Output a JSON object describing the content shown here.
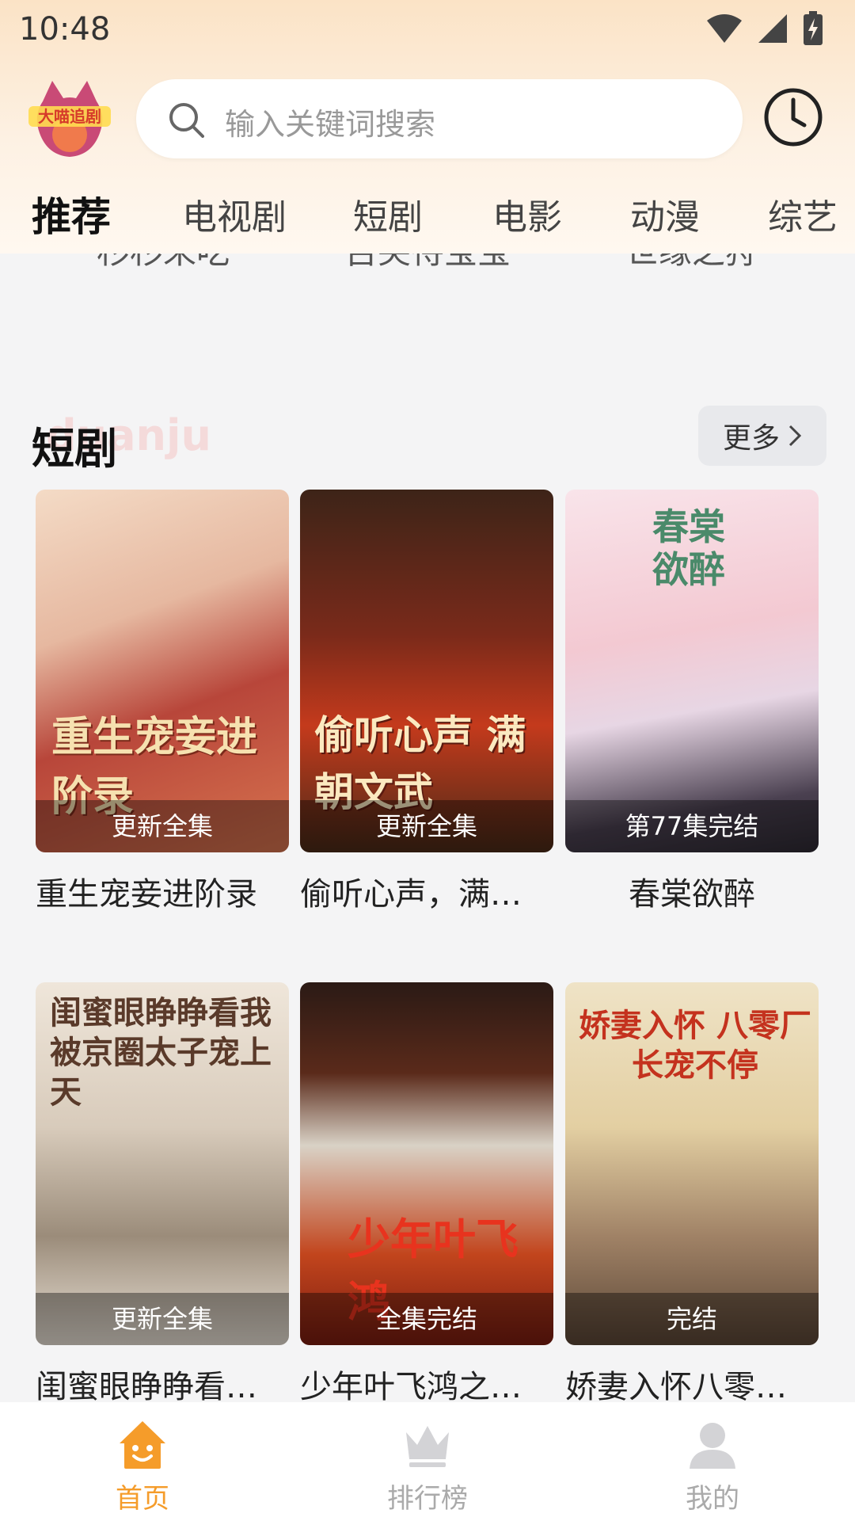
{
  "status_bar": {
    "time": "10:48"
  },
  "header": {
    "logo_text": "大喵追剧",
    "search_placeholder": "输入关键词搜索"
  },
  "tabs": [
    {
      "label": "推荐",
      "active": true
    },
    {
      "label": "电视剧"
    },
    {
      "label": "短剧"
    },
    {
      "label": "电影"
    },
    {
      "label": "动漫"
    },
    {
      "label": "综艺"
    }
  ],
  "previous_row_titles": [
    "杉杉来吃",
    "舌尖待宝宝",
    "世缘之狩"
  ],
  "section": {
    "title": "短剧",
    "watermark": "duanju",
    "more_label": "更多"
  },
  "cards": [
    {
      "title": "重生宠妾进阶录",
      "status": "更新全集",
      "poster_text": "重生宠妾进阶录"
    },
    {
      "title": "偷听心声，满…",
      "status": "更新全集",
      "poster_text": "偷听心声 满朝文武"
    },
    {
      "title": "春棠欲醉",
      "status": "第77集完结",
      "poster_text": "春棠欲醉"
    },
    {
      "title": "闺蜜眼睁睁看…",
      "status": "更新全集",
      "poster_text": "闺蜜眼睁睁看我被京圈太子宠上天"
    },
    {
      "title": "少年叶飞鸿之…",
      "status": "全集完结",
      "poster_text": "少年叶飞鸿"
    },
    {
      "title": "娇妻入怀八零…",
      "status": "完结",
      "poster_text": "娇妻入怀 八零厂长宠不停"
    }
  ],
  "bottom_nav": [
    {
      "label": "首页",
      "icon": "home-icon",
      "active": true
    },
    {
      "label": "排行榜",
      "icon": "crown-icon"
    },
    {
      "label": "我的",
      "icon": "profile-icon"
    }
  ],
  "colors": {
    "accent": "#f59c2a",
    "tab_highlight": "#f9c74a"
  }
}
